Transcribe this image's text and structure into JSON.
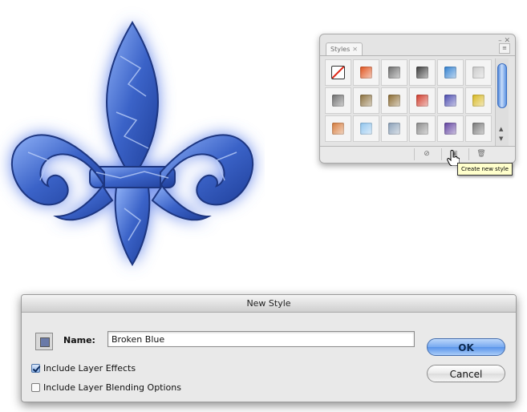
{
  "styles_panel": {
    "tab_label": "Styles",
    "tab_close": "✕",
    "window_controls": "– ✕",
    "menu_glyph": "≡",
    "swatches": [
      {
        "color": "none"
      },
      {
        "color": "#e0521c"
      },
      {
        "color": "#6b6b6b"
      },
      {
        "color": "#3a3a3a"
      },
      {
        "color": "#2f7fd0"
      },
      {
        "color": "#c9c9c9"
      },
      {
        "color": "#6d6d6d"
      },
      {
        "color": "#8a6f3c"
      },
      {
        "color": "#8a6a30"
      },
      {
        "color": "#d13a2a"
      },
      {
        "color": "#4a4ab0"
      },
      {
        "color": "#d8b820"
      },
      {
        "color": "#d67a3a"
      },
      {
        "color": "#8fc4ee"
      },
      {
        "color": "#8aa0b8"
      },
      {
        "color": "#8a8a8a"
      },
      {
        "color": "#6040a0"
      },
      {
        "color": "#777777"
      }
    ],
    "footer_buttons": [
      "⊘",
      "▣",
      "🗑"
    ],
    "scroll_up": "▲",
    "scroll_down": "▼",
    "tooltip": "Create new style"
  },
  "dialog": {
    "title": "New Style",
    "name_label": "Name:",
    "name_value": "Broken Blue",
    "include_layer_effects": {
      "label": "Include Layer Effects",
      "checked": true
    },
    "include_blending_options": {
      "label": "Include Layer Blending Options",
      "checked": false
    },
    "ok_label": "OK",
    "cancel_label": "Cancel"
  },
  "colors": {
    "artwork_blue": "#3b63c8",
    "artwork_glow": "#5a7ee8",
    "ok_blue": "#78aaf0"
  }
}
